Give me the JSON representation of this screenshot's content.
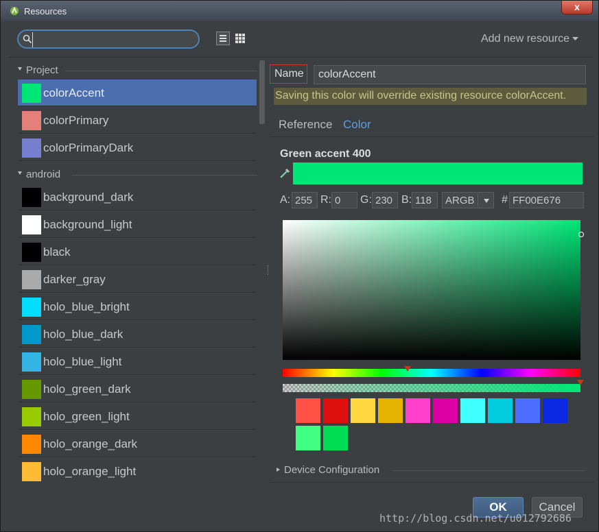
{
  "window": {
    "title": "Resources",
    "close_glyph": "x"
  },
  "toolbar": {
    "search_placeholder": "",
    "add_new_label": "Add new resource"
  },
  "groups": [
    {
      "label": "Project",
      "items": [
        {
          "name": "colorAccent",
          "color": "#00e676",
          "selected": true
        },
        {
          "name": "colorPrimary",
          "color": "#e57f79"
        },
        {
          "name": "colorPrimaryDark",
          "color": "#7680cf"
        }
      ]
    },
    {
      "label": "android",
      "items": [
        {
          "name": "background_dark",
          "color": "#000000"
        },
        {
          "name": "background_light",
          "color": "#ffffff"
        },
        {
          "name": "black",
          "color": "#000000"
        },
        {
          "name": "darker_gray",
          "color": "#aaaaaa"
        },
        {
          "name": "holo_blue_bright",
          "color": "#00ddff"
        },
        {
          "name": "holo_blue_dark",
          "color": "#0099cc"
        },
        {
          "name": "holo_blue_light",
          "color": "#33b5e5"
        },
        {
          "name": "holo_green_dark",
          "color": "#669900"
        },
        {
          "name": "holo_green_light",
          "color": "#99cc00"
        },
        {
          "name": "holo_orange_dark",
          "color": "#ff8800"
        },
        {
          "name": "holo_orange_light",
          "color": "#ffbb33"
        }
      ]
    }
  ],
  "editor": {
    "name_label": "Name",
    "name_value": "colorAccent",
    "warning": "Saving this color will override existing resource colorAccent.",
    "tabs": [
      "Reference",
      "Color"
    ],
    "active_tab": "Color",
    "color_name": "Green accent 400",
    "preview_color": "#00e676",
    "components": [
      {
        "label": "A:",
        "value": "255"
      },
      {
        "label": "R:",
        "value": "0"
      },
      {
        "label": "G:",
        "value": "230"
      },
      {
        "label": "B:",
        "value": "118"
      }
    ],
    "format": "ARGB",
    "hex_prefix": "#",
    "hex_value": "FF00E676",
    "hue_level": 0.42,
    "alpha_level": 1.0,
    "presets": [
      "#ff5045",
      "#e01010",
      "#ffd740",
      "#e3b300",
      "#ff40cc",
      "#dd00a5",
      "#40ffff",
      "#00ccdd",
      "#4d6dff",
      "#0a29e0",
      "#40ff82",
      "#00dd52"
    ],
    "device_config_label": "Device Configuration"
  },
  "buttons": {
    "ok": "OK",
    "cancel": "Cancel"
  },
  "watermark": "http://blog.csdn.net/u012792686"
}
